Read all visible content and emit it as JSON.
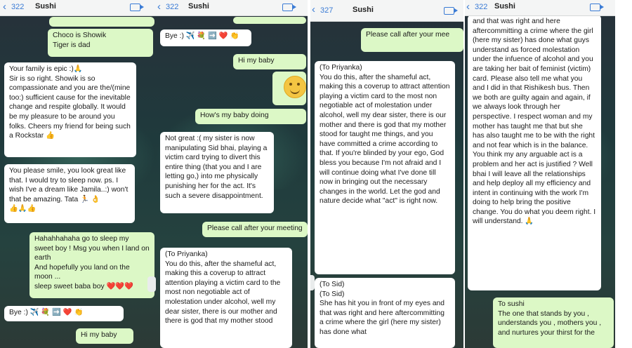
{
  "panels": [
    {
      "header": {
        "back": "<",
        "count": "322",
        "name": "Sushi"
      },
      "messages": [
        {
          "type": "out",
          "text": "Choco is Showik\nTiger is dad",
          "time": ""
        },
        {
          "type": "in",
          "text": "Your family is epic :)🙏\nSir is so right. Showik is so compassionate and you are the/(mine too:) sufficient cause for the inevitable change and respite globally. It would be my pleasure to be around you folks. Cheers my friend for being such a Rockstar 👍",
          "time": ""
        },
        {
          "type": "in",
          "text": "You please smile, you look great like that. I would try to sleep now. ps. I wish I've a dream like Jamila..:) won't that be amazing. Tata 🏃 👌\n👍🙏👍",
          "time": ""
        },
        {
          "type": "out",
          "text": "Hahahhahaha go to sleep my sweet boy ! Msg you when I land on earth\nAnd hopefully you land on the moon ...\nsleep sweet baba boy ❤️❤️❤️",
          "time": ""
        },
        {
          "type": "in",
          "text": "Bye :) ✈️ 💐 ➡️ ❤️ 👏",
          "time": ""
        },
        {
          "type": "out",
          "text": "Hi my baby",
          "time": ""
        }
      ]
    },
    {
      "header": {
        "back": "<",
        "count": "322",
        "name": "Sushi"
      },
      "messages": [
        {
          "type": "out",
          "text": "",
          "time": ""
        },
        {
          "type": "in",
          "text": "Bye :) ✈️ 💐 ➡️ ❤️ 👏",
          "time": ""
        },
        {
          "type": "out",
          "text": "Hi my baby",
          "time": ""
        },
        {
          "type": "out",
          "text": "How's my baby doing",
          "time": ""
        },
        {
          "type": "in",
          "text": "Not great :( my sister is now manipulating Sid bhai, playing a victim card trying to divert this entire thing (that you and I are letting go,) into me physically punishing her for the act. It's such a severe disappointment.",
          "time": ""
        },
        {
          "type": "out",
          "text": "Please call after your meeting",
          "time": ""
        },
        {
          "type": "in",
          "text": "(To Priyanka)\nYou do this, after the shameful act, making this a coverup to attract attention playing a victim card to the most non negotiable act of molestation under alcohol, well my dear sister, there is our mother and there is god that my mother stood",
          "time": ""
        }
      ]
    },
    {
      "header": {
        "back": "<",
        "count": "327",
        "name": "Sushi"
      },
      "messages": [
        {
          "type": "out",
          "text": "Please call after your mee",
          "time": ""
        },
        {
          "type": "in",
          "text": "(To Priyanka)\nYou do this, after the shameful act, making this a coverup to attract attention playing a victim card to the most non negotiable act of molestation under alcohol, well my dear sister, there is our mother and there is god that my mother stood for taught me things, and you have committed a crime according to that. If you're blinded by your ego, God bless you because I'm not afraid and I will continue doing what I've done till now in bringing out the necessary changes in the world. Let the god and nature decide what \"act\" is right now.",
          "time": ""
        },
        {
          "type": "in",
          "text": "(To Sid)\n(To Sid)\nShe has hit you in front of my eyes and that was right and here aftercommitting a crime where the girl (here my sister) has done what",
          "time": ""
        }
      ]
    },
    {
      "header": {
        "back": "<",
        "count": "322",
        "name": "Sushi"
      },
      "messages": [
        {
          "type": "in",
          "text": "and that was right and here aftercommitting a crime where the girl (here my sister) has done what guys understand as forced molestation under the infuence of alcohol and you are taking her bait of feminist (victim) card. Please also tell me what you and I did in that Rishikesh bus. Then we both are guilty again and again, if we always look through her perspective. I respect woman and my mother has taught me that but she has also taught me to be with the right and not fear which is in the balance. You think my any arguable act is a problem and her act is justified ? Well bhai I will leave all the relationships and help deploy all my efficiency and intent in continuing with the work I'm doing to help bring the positive change. You do what you deem right. I will understand. 🙏",
          "time": ""
        },
        {
          "type": "out",
          "text": "To sushi\nThe one that stands by you , understands you , mothers you , and nurtures your thirst for the",
          "time": ""
        }
      ]
    }
  ]
}
